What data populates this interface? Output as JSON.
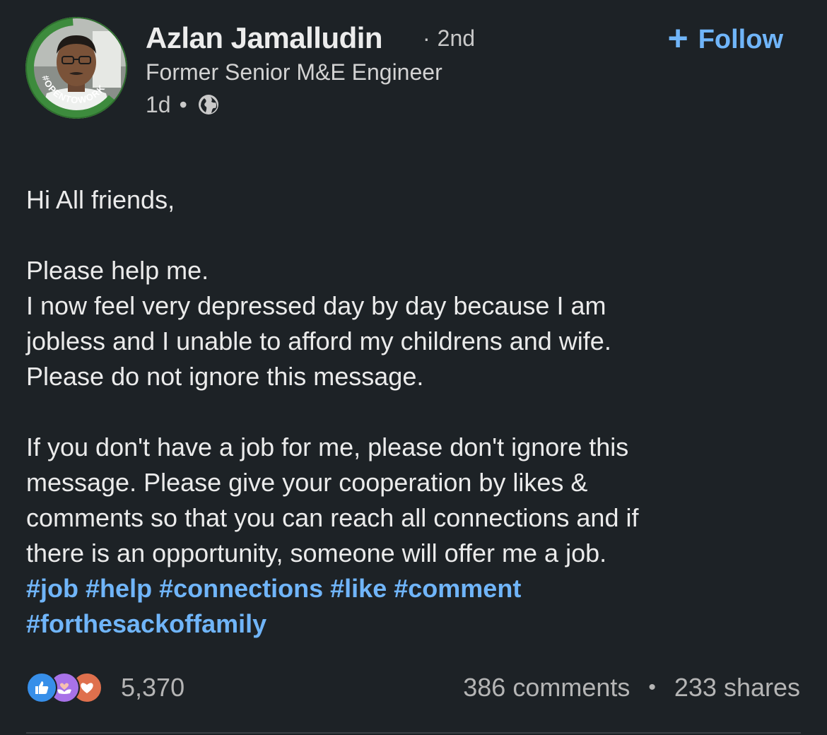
{
  "author": {
    "name": "Azlan Jamalludin",
    "degree_sep": "·",
    "degree": "2nd",
    "headline": "Former Senior M&E Engineer",
    "time": "1d",
    "time_sep": "•",
    "visibility_icon": "globe-icon",
    "avatar_badge": "#OPENTOWORK"
  },
  "follow": {
    "icon": "plus-icon",
    "label": "Follow"
  },
  "post": {
    "greeting": "Hi All friends,",
    "line1": "Please help me.",
    "line2": "I now feel very depressed day by day because I am",
    "line3": "jobless and I unable to afford my childrens and wife.",
    "line4": "Please do not ignore this message.",
    "line5": "If you don't have a job for me, please don't ignore this",
    "line6": "message. Please give your cooperation by likes &",
    "line7": "comments so that you can reach all connections and if",
    "line8": "there is an opportunity, someone will offer me a job.",
    "hashtags": [
      "#job",
      "#help",
      "#connections",
      "#like",
      "#comment",
      "#forthesackoffamily"
    ]
  },
  "social": {
    "reaction_icons": [
      "like-icon",
      "support-icon",
      "love-icon"
    ],
    "reactions": "5,370",
    "comments": "386 comments",
    "separator": "•",
    "shares": "233 shares"
  },
  "colors": {
    "background": "#1d2226",
    "link": "#70b5f9",
    "text": "#ebebeb",
    "muted": "#b5b5b5",
    "open_to_work": "#3d8b3d"
  }
}
